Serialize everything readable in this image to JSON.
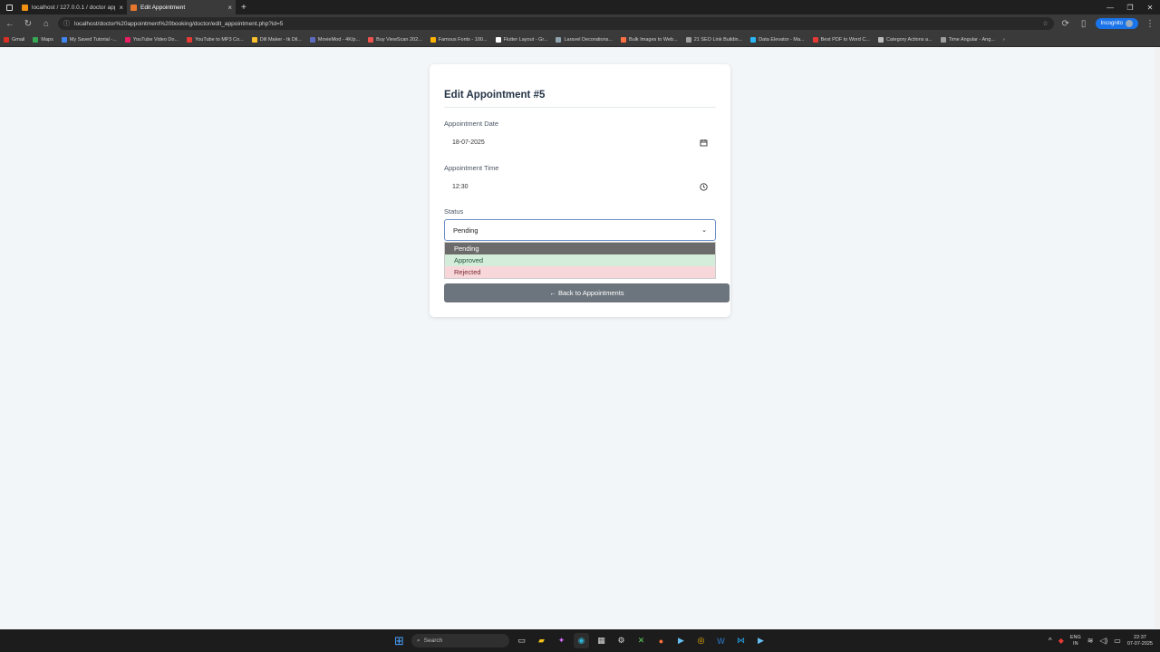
{
  "browser": {
    "tabs": [
      {
        "title": "localhost / 127.0.0.1 / doctor app",
        "active": false,
        "favicon_color": "#f29111"
      },
      {
        "title": "Edit Appointment",
        "active": true,
        "favicon_color": "#e8772e"
      }
    ],
    "url": "localhost/doctor%20appointment%20booking/doctor/edit_appointment.php?id=5",
    "profile_label": "Incognito",
    "bookmarks": [
      {
        "label": "Gmail",
        "color": "#d93025"
      },
      {
        "label": "Maps",
        "color": "#34a853"
      },
      {
        "label": "My Saved Tutorial -...",
        "color": "#4285f4"
      },
      {
        "label": "YouTube Video Do...",
        "color": "#e91e63"
      },
      {
        "label": "YouTube to MP3 Co...",
        "color": "#e53935"
      },
      {
        "label": "Dill Maker - tk Dil...",
        "color": "#fbc02d"
      },
      {
        "label": "MovieMod - 4K/p...",
        "color": "#5c6bc0"
      },
      {
        "label": "Buy ViewScan 202...",
        "color": "#ef5350"
      },
      {
        "label": "Famous Fonts - 100...",
        "color": "#ffb300"
      },
      {
        "label": "Flutter Layout - Gr...",
        "color": "#ffffff"
      },
      {
        "label": "Laravel Decorations...",
        "color": "#90a4ae"
      },
      {
        "label": "Bulk Images to Web...",
        "color": "#ff7043"
      },
      {
        "label": "21 SEO Link Buildin...",
        "color": "#9e9e9e"
      },
      {
        "label": "Data Elevator - Ma...",
        "color": "#29b6f6"
      },
      {
        "label": "Best PDF to Word C...",
        "color": "#e53935"
      },
      {
        "label": "Category Actions a...",
        "color": "#bdbdbd"
      },
      {
        "label": "Time Angular - Ang...",
        "color": "#9e9e9e"
      }
    ]
  },
  "form": {
    "title": "Edit Appointment #5",
    "date_label": "Appointment Date",
    "date_value": "18-07-2025",
    "time_label": "Appointment Time",
    "time_value": "12:30",
    "status_label": "Status",
    "status_value": "Pending",
    "status_options": [
      "Pending",
      "Approved",
      "Rejected"
    ],
    "back_button": "← Back to Appointments"
  },
  "taskbar": {
    "search_placeholder": "Search",
    "lang": "ENG",
    "lang_sub": "IN",
    "time": "22:37",
    "date": "07-07-2025"
  }
}
